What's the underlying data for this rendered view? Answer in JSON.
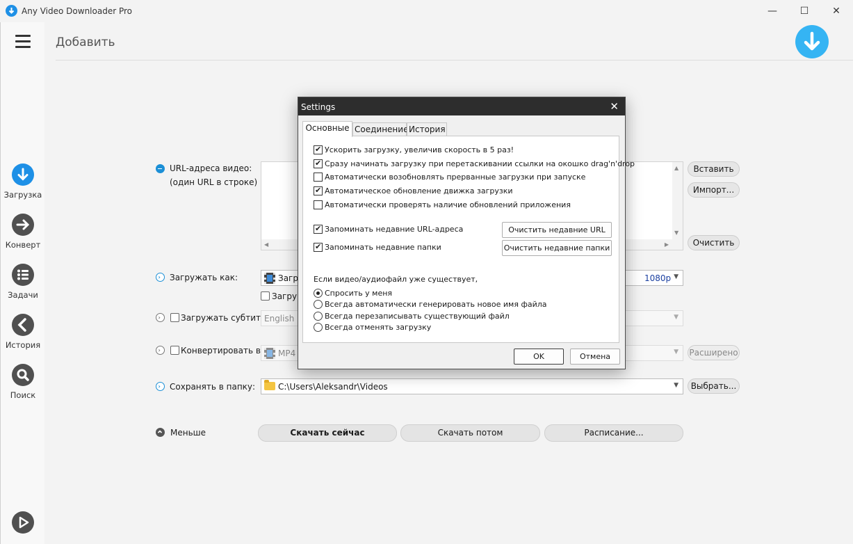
{
  "window": {
    "title": "Any Video Downloader Pro",
    "minimize": "—",
    "maximize": "☐",
    "close": "✕"
  },
  "sidebar": {
    "items": [
      {
        "label": "Загрузка",
        "color": "#1e90e6"
      },
      {
        "label": "Конверт",
        "color": "#505050"
      },
      {
        "label": "Задачи",
        "color": "#505050"
      },
      {
        "label": "История",
        "color": "#505050"
      },
      {
        "label": "Поиск",
        "color": "#505050"
      }
    ]
  },
  "main": {
    "page_title": "Добавить",
    "url_label_1": "URL-адреса видео:",
    "url_label_2": "(один URL в строке)",
    "paste_button": "Вставить",
    "import_button": "Импорт...",
    "clear_button": "Очистить",
    "download_as_label": "Загружать как:",
    "download_as_value": "Загру",
    "download_as_quality": "1080p",
    "sub_checkbox_label": "Загру",
    "subtitles_label": "Загружать субтитры:",
    "subtitles_value": "English",
    "convert_label": "Конвертировать в:",
    "convert_value": "MP4",
    "advanced_button": "Расширено",
    "save_to_label": "Сохранять в папку:",
    "save_to_value": "C:\\Users\\Aleksandr\\Videos",
    "browse_button": "Выбрать...",
    "less_label": "Меньше",
    "download_now": "Скачать сейчас",
    "download_later": "Скачать потом",
    "schedule": "Расписание..."
  },
  "dialog": {
    "title": "Settings",
    "close": "✕",
    "tabs": [
      "Основные",
      "Соединение",
      "История"
    ],
    "options": [
      {
        "label": "Ускорить загрузку, увеличив скорость в 5 раз!",
        "checked": true
      },
      {
        "label": "Сразу начинать загрузку при перетаскивании ссылки на окошко drag'n'drop",
        "checked": true
      },
      {
        "label": "Автоматически возобновлять прерванные загрузки при запуске",
        "checked": false
      },
      {
        "label": "Автоматическое обновление движка загрузки",
        "checked": true
      },
      {
        "label": "Автоматически проверять наличие обновлений приложения",
        "checked": false
      }
    ],
    "remember_urls": "Запоминать недавние URL-адреса",
    "remember_folders": "Запоминать недавние папки",
    "clear_urls_button": "Очистить недавние URL",
    "clear_folders_button": "Очистить недавние папки",
    "exists_label": "Если видео/аудиофайл уже существует,",
    "radios": [
      {
        "label": "Спросить у меня",
        "selected": true
      },
      {
        "label": "Всегда автоматически генерировать новое имя файла",
        "selected": false
      },
      {
        "label": "Всегда перезаписывать существующий файл",
        "selected": false
      },
      {
        "label": "Всегда отменять загрузку",
        "selected": false
      }
    ],
    "ok_button": "OK",
    "cancel_button": "Отмена"
  },
  "colors": {
    "accent": "#1e90e6",
    "big_download": "#35b4f3",
    "dialog_titlebar": "#2d2d2d"
  }
}
